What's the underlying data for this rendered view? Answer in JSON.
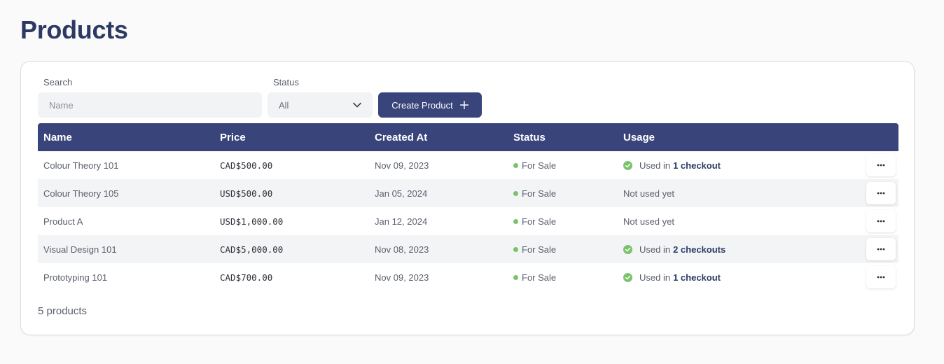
{
  "page": {
    "title": "Products"
  },
  "filters": {
    "search_label": "Search",
    "search_placeholder": "Name",
    "status_label": "Status",
    "status_value": "All",
    "create_button": "Create Product"
  },
  "table": {
    "columns": [
      "Name",
      "Price",
      "Created At",
      "Status",
      "Usage"
    ],
    "rows": [
      {
        "name": "Colour Theory 101",
        "price": "CAD$500.00",
        "created": "Nov 09, 2023",
        "status": "For Sale",
        "used": true,
        "usage_prefix": "Used in",
        "usage_count": "1 checkout",
        "usage_text": ""
      },
      {
        "name": "Colour Theory 105",
        "price": "USD$500.00",
        "created": "Jan 05, 2024",
        "status": "For Sale",
        "used": false,
        "usage_prefix": "",
        "usage_count": "",
        "usage_text": "Not used yet"
      },
      {
        "name": "Product A",
        "price": "USD$1,000.00",
        "created": "Jan 12, 2024",
        "status": "For Sale",
        "used": false,
        "usage_prefix": "",
        "usage_count": "",
        "usage_text": "Not used yet"
      },
      {
        "name": "Visual Design 101",
        "price": "CAD$5,000.00",
        "created": "Nov 08, 2023",
        "status": "For Sale",
        "used": true,
        "usage_prefix": "Used in",
        "usage_count": "2 checkouts",
        "usage_text": ""
      },
      {
        "name": "Prototyping 101",
        "price": "CAD$700.00",
        "created": "Nov 09, 2023",
        "status": "For Sale",
        "used": true,
        "usage_prefix": "Used in",
        "usage_count": "1 checkout",
        "usage_text": ""
      }
    ]
  },
  "footer": {
    "count": "5 products"
  },
  "icons": {
    "status_select": "chevron-down-icon",
    "create": "plus-icon",
    "usage": "check-circle-icon",
    "row_menu": "more-horizontal-icon"
  },
  "colors": {
    "primary": "#38447a",
    "title": "#2c3a63",
    "success": "#7bc36a"
  }
}
